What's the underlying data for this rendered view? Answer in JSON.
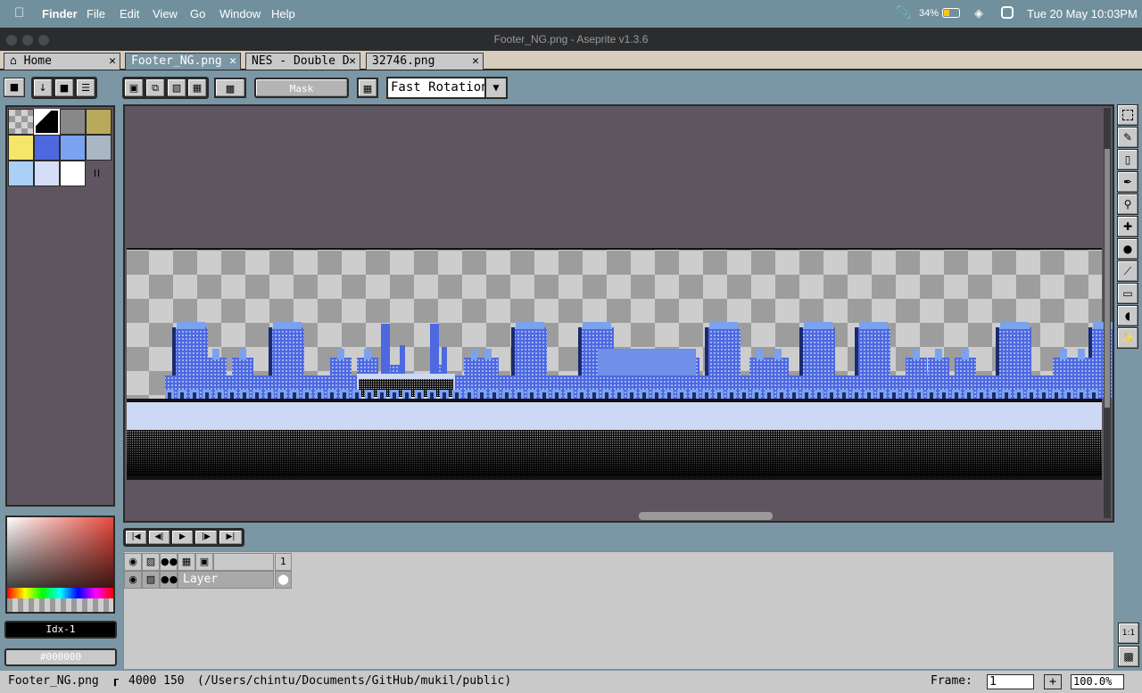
{
  "menubar": {
    "app": "Finder",
    "items": [
      "File",
      "Edit",
      "View",
      "Go",
      "Window",
      "Help"
    ],
    "battery": "34%",
    "datetime": "Tue 20 May  10:03PM"
  },
  "window": {
    "title": "Footer_NG.png - Aseprite v1.3.6"
  },
  "tabs": [
    {
      "label": "Home",
      "icon": "home-icon"
    },
    {
      "label": "Footer_NG.png"
    },
    {
      "label": "NES - Double D"
    },
    {
      "label": "32746.png"
    }
  ],
  "toolbar": {
    "mask_label": "Mask",
    "rotation_select": "Fast Rotation"
  },
  "palette": {
    "colors": [
      "#c0c0c0",
      "#000000",
      "#888888",
      "#b8aa5a",
      "#f5e66b",
      "#4e68e0",
      "#7aa2ef",
      "#a9b6c3",
      "#aad0f5",
      "#d6def7",
      "#ffffff"
    ],
    "selected_color": "#000000"
  },
  "color": {
    "index_label": "Idx-1",
    "hex_label": "#000000"
  },
  "timeline": {
    "frame_header": "1",
    "layer_name": "Layer"
  },
  "status": {
    "filename": "Footer_NG.png",
    "size": "4000 150",
    "path": "(/Users/chintu/Documents/GitHub/mukil/public)",
    "frame_label": "Frame:",
    "frame_value": "1",
    "zoom": "100.0%"
  },
  "colors": {
    "canvas_bg": "#5f5560",
    "ui_bg": "#7b96a4",
    "panel": "#c9c9c9",
    "sky_band": "#cdd8f5",
    "building": "#4e68e0"
  }
}
